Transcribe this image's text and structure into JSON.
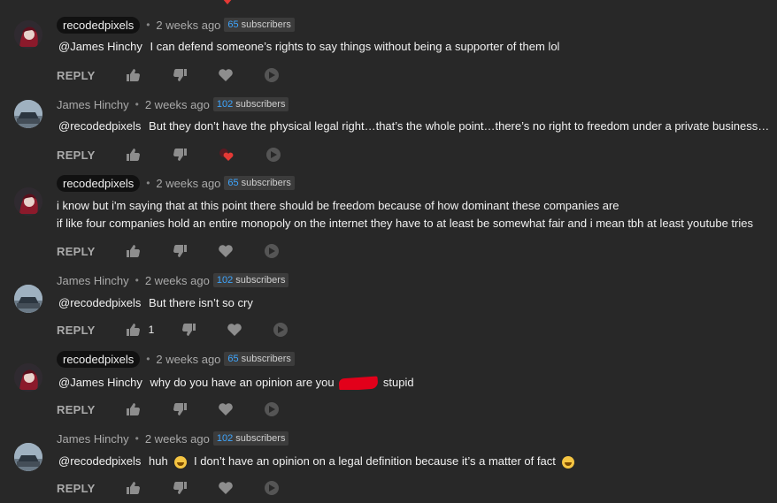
{
  "comments": [
    {
      "author": "recodedpixels",
      "time": "2 weeks ago",
      "subs_num": "65",
      "subs_label": "subscribers",
      "mention": "@James Hinchy",
      "text": "I can defend someone’s rights to say things without being a supporter of them lol",
      "reply": "REPLY"
    },
    {
      "author": "James Hinchy",
      "time": "2 weeks ago",
      "subs_num": "102",
      "subs_label": "subscribers",
      "mention": "@recodedpixels",
      "text": "But they don’t have the physical legal right…that’s the whole point…there’s no right to freedom under a private business ffs...",
      "reply": "REPLY"
    },
    {
      "author": "recodedpixels",
      "time": "2 weeks ago",
      "subs_num": "65",
      "subs_label": "subscribers",
      "line1": "i know but i'm saying that at this point there should be freedom because of how dominant these companies are",
      "line2": "if like four companies hold an entire monopoly on the internet they have to at least be somewhat fair and i mean tbh at least youtube tries",
      "reply": "REPLY"
    },
    {
      "author": "James Hinchy",
      "time": "2 weeks ago",
      "subs_num": "102",
      "subs_label": "subscribers",
      "mention": "@recodedpixels",
      "text": "But there isn’t so cry",
      "reply": "REPLY",
      "like_count": "1"
    },
    {
      "author": "recodedpixels",
      "time": "2 weeks ago",
      "subs_num": "65",
      "subs_label": "subscribers",
      "mention": "@James Hinchy",
      "text_before": "why do you have an opinion are you",
      "text_after": "stupid",
      "reply": "REPLY"
    },
    {
      "author": "James Hinchy",
      "time": "2 weeks ago",
      "subs_num": "102",
      "subs_label": "subscribers",
      "mention": "@recodedpixels",
      "text_before": "huh",
      "text_after": "I don’t have an opinion on a legal definition because it’s a matter of fact",
      "reply": "REPLY"
    }
  ],
  "colors": {
    "background": "#282828",
    "accent": "#3ea6ff",
    "heart": "#e53935",
    "redaction": "#e2001a"
  },
  "icons": [
    "thumbs-up-icon",
    "thumbs-down-icon",
    "heart-icon",
    "reply-arrow-icon",
    "emoji-icon"
  ]
}
